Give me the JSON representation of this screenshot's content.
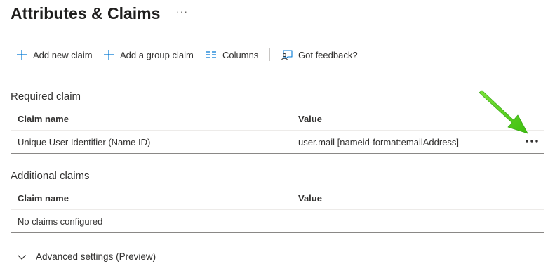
{
  "page": {
    "title": "Attributes & Claims",
    "more_label": "···"
  },
  "toolbar": {
    "items": [
      {
        "label": "Add new claim",
        "icon": "plus-icon"
      },
      {
        "label": "Add a group claim",
        "icon": "plus-icon"
      },
      {
        "label": "Columns",
        "icon": "columns-icon"
      },
      {
        "label": "Got feedback?",
        "icon": "feedback-icon"
      }
    ]
  },
  "required_claim": {
    "title": "Required claim",
    "columns": [
      "Claim name",
      "Value"
    ],
    "rows": [
      {
        "claim_name": "Unique User Identifier (Name ID)",
        "value": "user.mail [nameid-format:emailAddress]"
      }
    ]
  },
  "additional_claims": {
    "title": "Additional claims",
    "columns": [
      "Claim name",
      "Value"
    ],
    "empty_text": "No claims configured"
  },
  "advanced": {
    "label": "Advanced settings (Preview)",
    "icon": "chevron-down-icon"
  },
  "colors": {
    "accent": "#0078d4",
    "annotation_arrow": "#5ad31e",
    "text": "#323130",
    "divider": "#e1dfdd"
  }
}
